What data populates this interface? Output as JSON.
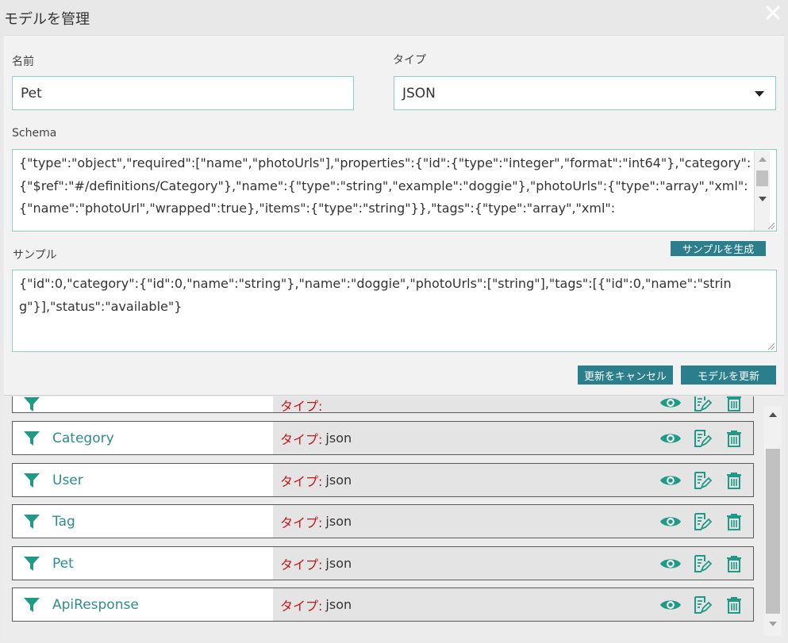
{
  "dialog": {
    "title": "モデルを管理",
    "name_label": "名前",
    "name_value": "Pet",
    "type_label": "タイプ",
    "type_value": "JSON",
    "schema_label": "Schema",
    "schema_text": "{\"type\":\"object\",\"required\":[\"name\",\"photoUrls\"],\"properties\":{\"id\":{\"type\":\"integer\",\"format\":\"int64\"},\"category\":{\"$ref\":\"#/definitions/Category\"},\"name\":{\"type\":\"string\",\"example\":\"doggie\"},\"photoUrls\":{\"type\":\"array\",\"xml\":{\"name\":\"photoUrl\",\"wrapped\":true},\"items\":{\"type\":\"string\"}},\"tags\":{\"type\":\"array\",\"xml\":",
    "sample_label": "サンプル",
    "generate_sample_button": "サンプルを生成",
    "sample_text": "{\"id\":0,\"category\":{\"id\":0,\"name\":\"string\"},\"name\":\"doggie\",\"photoUrls\":[\"string\"],\"tags\":[{\"id\":0,\"name\":\"string\"}],\"status\":\"available\"}",
    "cancel_button": "更新をキャンセル",
    "update_button": "モデルを更新"
  },
  "list": {
    "type_label": "タイプ:",
    "rows": [
      {
        "name": "",
        "type": ""
      },
      {
        "name": "Category",
        "type": "json"
      },
      {
        "name": "User",
        "type": "json"
      },
      {
        "name": "Tag",
        "type": "json"
      },
      {
        "name": "Pet",
        "type": "json"
      },
      {
        "name": "ApiResponse",
        "type": "json"
      }
    ]
  },
  "colors": {
    "accent": "#2b7f8c",
    "name_text": "#2f8c8c",
    "type_label": "#c0181d",
    "icon": "#1f9a86"
  },
  "icons": {
    "filter": "filter-icon",
    "view": "eye-icon",
    "edit": "edit-icon",
    "delete": "trash-icon",
    "close": "close-icon"
  }
}
